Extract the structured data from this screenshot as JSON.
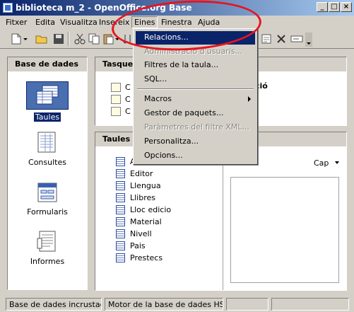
{
  "window": {
    "title": "biblioteca m_2 - OpenOffice.org Base",
    "minimize_glyph": "_",
    "maximize_glyph": "□",
    "close_glyph": "×"
  },
  "menubar": {
    "items": [
      "Fitxer",
      "Edita",
      "Visualitza",
      "Insereix",
      "Eines",
      "Finestra",
      "Ajuda"
    ],
    "active": "Eines"
  },
  "toolbar": {
    "icons": [
      "new-document-icon",
      "dropdown-arrow-icon",
      "open-folder-icon",
      "save-icon",
      "cut-icon",
      "copy-icon",
      "paste-icon",
      "dropdown-arrow-icon",
      "sort-icon",
      "table-icon",
      "form-icon",
      "report-icon",
      "delete-icon",
      "rename-icon",
      "toolbar-options-icon"
    ]
  },
  "eines_menu": {
    "items": [
      {
        "label": "Relacions...",
        "state": "highlighted"
      },
      {
        "label": "Administració d'usuaris...",
        "state": "disabled"
      },
      {
        "label": "Filtres de la taula...",
        "state": "enabled"
      },
      {
        "label": "SQL...",
        "state": "enabled"
      },
      {
        "label": "Macros",
        "state": "submenu"
      },
      {
        "label": "Gestor de paquets...",
        "state": "enabled"
      },
      {
        "label": "Paràmetres del filtre XML...",
        "state": "disabled"
      },
      {
        "label": "Personalitza...",
        "state": "enabled"
      },
      {
        "label": "Opcions...",
        "state": "enabled"
      }
    ]
  },
  "left_panel": {
    "header": "Base de dades",
    "categories": [
      {
        "label": "Taules",
        "icon": "tables-icon",
        "selected": true
      },
      {
        "label": "Consultes",
        "icon": "queries-icon",
        "selected": false
      },
      {
        "label": "Formularis",
        "icon": "forms-icon",
        "selected": false
      },
      {
        "label": "Informes",
        "icon": "reports-icon",
        "selected": false
      }
    ]
  },
  "tasks_panel": {
    "header": "Tasques",
    "item_initial": "C",
    "description_fragment": "ció"
  },
  "tables_panel": {
    "header": "Taules",
    "items": [
      "A",
      "Editor",
      "Llengua",
      "Llibres",
      "Lloc edicio",
      "Material",
      "Nivell",
      "Pais",
      "Prestecs"
    ],
    "preview_selector": "Cap"
  },
  "statusbar": {
    "left": "Base de dades incrustada",
    "middle": "Motor de la base de dades HSQL"
  },
  "colors": {
    "selection": "#0a246a",
    "annotation": "#e8141e",
    "chrome": "#d4d0c8"
  }
}
